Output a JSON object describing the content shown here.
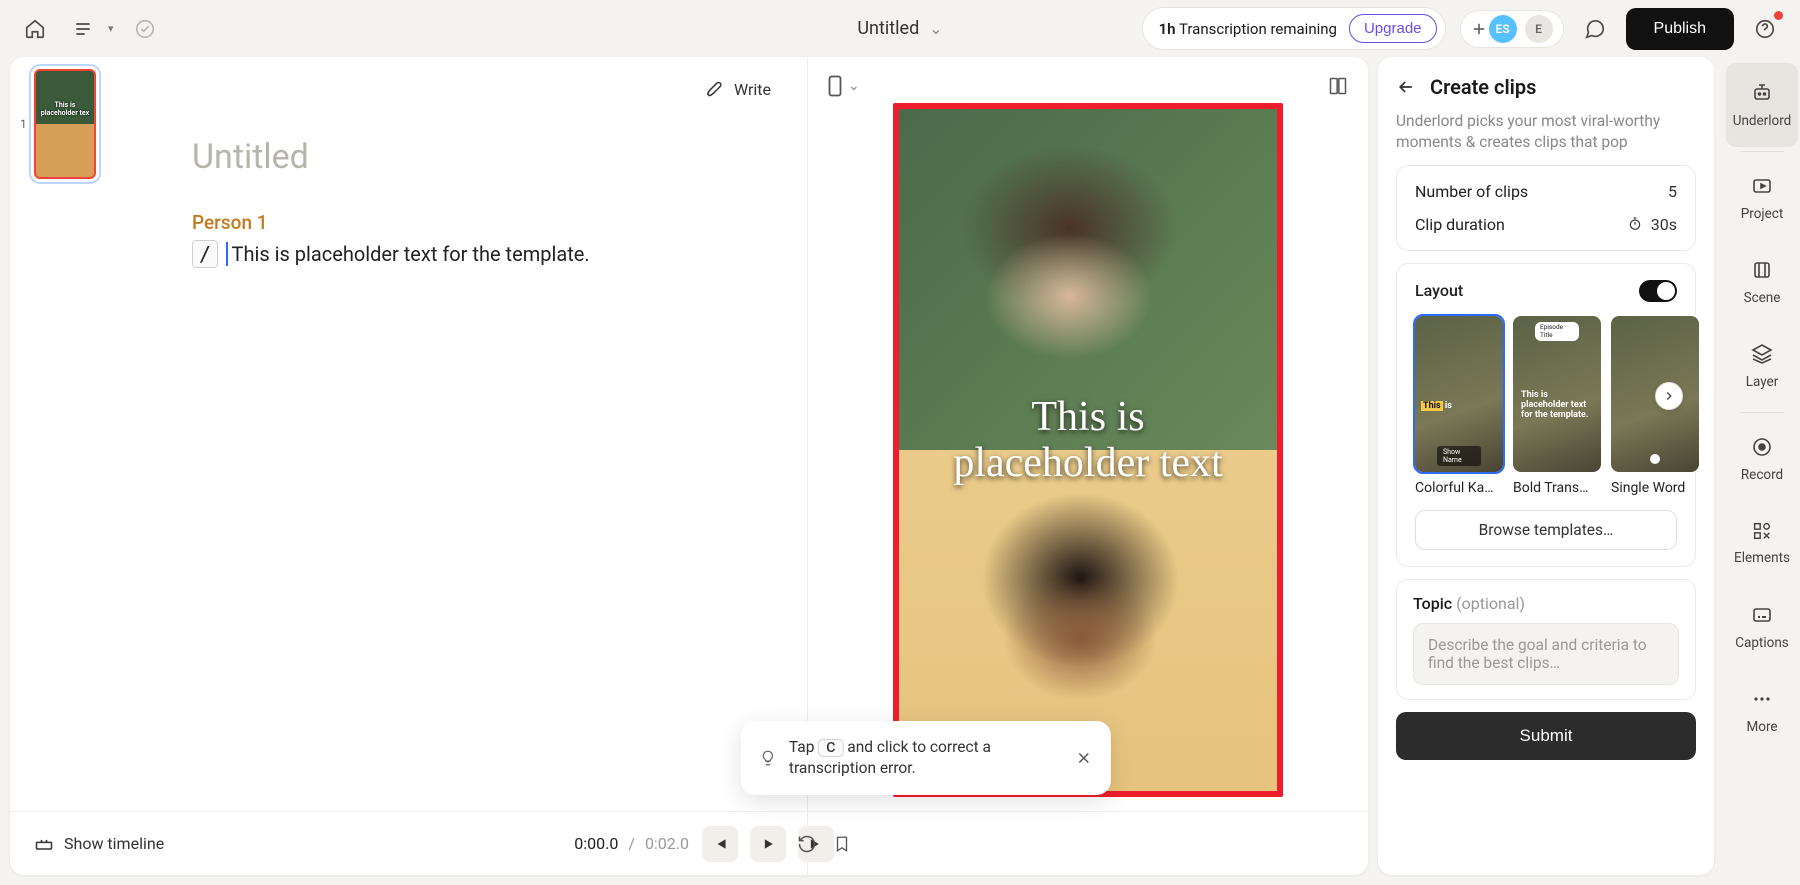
{
  "top": {
    "title": "Untitled",
    "transcription_prefix": "1h",
    "transcription_text": "Transcription remaining",
    "upgrade": "Upgrade",
    "publish": "Publish",
    "avatar1": "ES",
    "avatar2": "E"
  },
  "thumbs": {
    "n1": "1"
  },
  "editor": {
    "write": "Write",
    "doc_title": "Untitled",
    "speaker": "Person 1",
    "slash": "/",
    "line": "This is placeholder text for the template."
  },
  "preview": {
    "caption_l1": "This is",
    "caption_l2": "placeholder text"
  },
  "tip": {
    "pre": "Tap ",
    "key": "C",
    "post": " and click to correct a transcription error."
  },
  "bottom": {
    "show_timeline": "Show timeline",
    "cur": "0:00.0",
    "sep": "/",
    "dur": "0:02.0"
  },
  "rp": {
    "title": "Create clips",
    "desc": "Underlord picks your most viral-worthy moments & creates clips that pop",
    "num_label": "Number of clips",
    "num_val": "5",
    "dur_label": "Clip duration",
    "dur_val": "30s",
    "layout_label": "Layout",
    "layouts": {
      "a": "Colorful Ka…",
      "b": "Bold Trans…",
      "c": "Single Word"
    },
    "thumb_a_w1": "This",
    "thumb_a_w2": "is",
    "thumb_a_badge": "Show Name",
    "thumb_b_top": "Episode Title",
    "thumb_b_cap": "This is placeholder text for the template.",
    "browse": "Browse templates…",
    "topic": "Topic",
    "opt": "(optional)",
    "topic_ph": "Describe the goal and criteria to find the best clips…",
    "submit": "Submit"
  },
  "rail": {
    "underlord": "Underlord",
    "project": "Project",
    "scene": "Scene",
    "layer": "Layer",
    "record": "Record",
    "elements": "Elements",
    "captions": "Captions",
    "more": "More"
  }
}
